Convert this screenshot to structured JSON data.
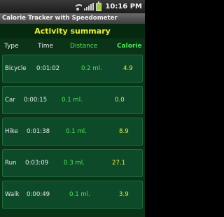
{
  "status_bar": {
    "time": "10:16 PM",
    "icons": [
      "wifi-icon",
      "signal-icon",
      "battery-icon"
    ]
  },
  "app": {
    "title": "Calorie Tracker with Speedometer"
  },
  "summary": {
    "heading": "Activity summary",
    "columns": {
      "type": "Type",
      "time": "Time",
      "distance": "Distance",
      "calorie": "Calorie"
    },
    "rows": [
      {
        "type": "Bicycle",
        "time": "0:01:02",
        "distance": "0.2 ml.",
        "calorie": "4.9"
      },
      {
        "type": "Car",
        "time": "0:00:15",
        "distance": "0.1 ml.",
        "calorie": "0.0"
      },
      {
        "type": "Hike",
        "time": "0:01:38",
        "distance": "0.1 ml.",
        "calorie": "8.9"
      },
      {
        "type": "Run",
        "time": "0:03:09",
        "distance": "0.3 ml.",
        "calorie": "27.1"
      },
      {
        "type": "Walk",
        "time": "0:00:49",
        "distance": "0.1 ml.",
        "calorie": "3.9"
      }
    ]
  },
  "colors": {
    "heading_text": "#f2f216",
    "distance_text": "#48ea50",
    "calorie_text": "#e6e82a",
    "panel_bg": "#0a3318",
    "row_bg": "#0d4a2a"
  }
}
